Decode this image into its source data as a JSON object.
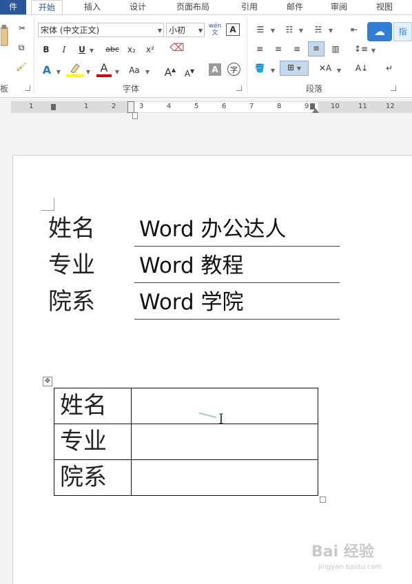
{
  "tabs": {
    "file": "件",
    "home": "开始",
    "insert": "插入",
    "design": "设计",
    "layout": "页面布局",
    "references": "引用",
    "mailings": "邮件",
    "review": "审阅",
    "view": "视图"
  },
  "ribbon": {
    "clipboard_label": "板",
    "font_label": "字体",
    "paragraph_label": "段落",
    "font_name": "宋体 (中文正文)",
    "font_size": "小初",
    "bold": "B",
    "italic": "I",
    "underline": "U",
    "strike": "abc",
    "subscript": "x₂",
    "superscript": "x²",
    "grow_font": "A",
    "shrink_font": "A",
    "change_case": "Aa",
    "font_color": "A",
    "text_effects": "A",
    "char_shading": "A",
    "enclose_char": "字",
    "phonetic_guide": "wén",
    "char_border": "A",
    "accent_color": "#2b579a",
    "right_panel_label": "指"
  },
  "ruler": {
    "numbers": [
      "1",
      "1",
      "2",
      "3",
      "4",
      "5",
      "6",
      "7",
      "8",
      "9",
      "10",
      "11",
      "12"
    ]
  },
  "document": {
    "lines": [
      {
        "label": "姓名",
        "value": "Word 办公达人"
      },
      {
        "label": "专业",
        "value": "Word 教程"
      },
      {
        "label": "院系",
        "value": "Word 学院"
      }
    ],
    "table_rows": [
      {
        "label": "姓名"
      },
      {
        "label": "专业"
      },
      {
        "label": "院系"
      }
    ]
  },
  "watermark": {
    "logo": "Bai 经验",
    "url": "jingyan.baidu.com"
  }
}
